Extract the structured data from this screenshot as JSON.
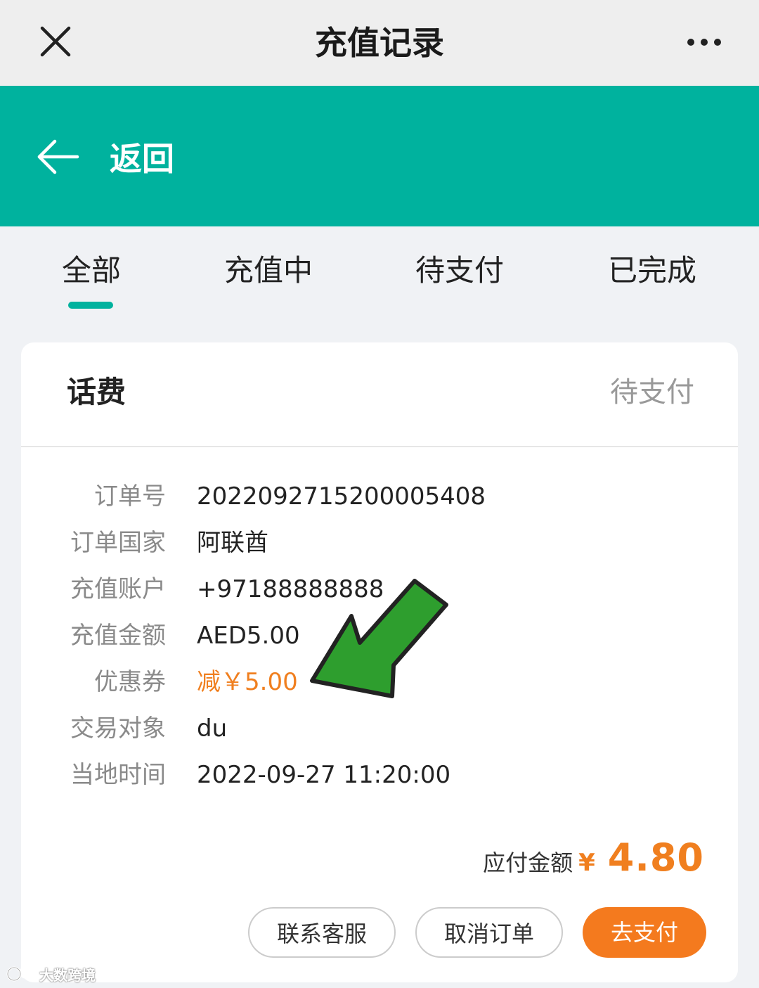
{
  "window": {
    "title": "充值记录"
  },
  "header": {
    "back_label": "返回"
  },
  "tabs": [
    {
      "label": "全部",
      "active": true
    },
    {
      "label": "充值中",
      "active": false
    },
    {
      "label": "待支付",
      "active": false
    },
    {
      "label": "已完成",
      "active": false
    }
  ],
  "order": {
    "type": "话费",
    "status": "待支付",
    "rows": [
      {
        "label": "订单号",
        "value": "2022092715200005408"
      },
      {
        "label": "订单国家",
        "value": "阿联酋"
      },
      {
        "label": "充值账户",
        "value": "+97188888888"
      },
      {
        "label": "充值金额",
        "value": "AED5.00"
      },
      {
        "label": "优惠券",
        "value": "减￥5.00"
      },
      {
        "label": "交易对象",
        "value": "du"
      },
      {
        "label": "当地时间",
        "value": "2022-09-27 11:20:00"
      }
    ],
    "total_label": "应付金额",
    "total_currency": "¥",
    "total_amount": "4.80"
  },
  "actions": {
    "contact_label": "联系客服",
    "cancel_label": "取消订单",
    "pay_label": "去支付"
  },
  "watermark": {
    "text": "大数跨境"
  },
  "colors": {
    "brand_green": "#00b29e",
    "accent_orange": "#f47a1e",
    "annotation_arrow": "#2e9e2e"
  }
}
